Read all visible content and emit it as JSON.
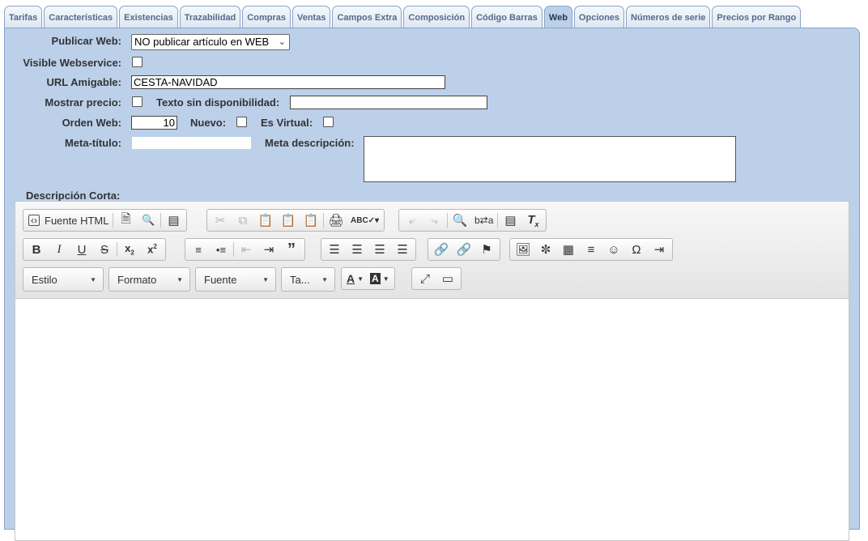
{
  "tabs": [
    {
      "label": "Tarifas"
    },
    {
      "label": "Características"
    },
    {
      "label": "Existencias"
    },
    {
      "label": "Trazabilidad"
    },
    {
      "label": "Compras"
    },
    {
      "label": "Ventas"
    },
    {
      "label": "Campos Extra"
    },
    {
      "label": "Composición"
    },
    {
      "label": "Código Barras"
    },
    {
      "label": "Web",
      "active": true
    },
    {
      "label": "Opciones"
    },
    {
      "label": "Números de serie"
    },
    {
      "label": "Precios por Rango"
    }
  ],
  "form": {
    "publicar_web_label": "Publicar Web:",
    "publicar_web_value": "NO publicar artículo en WEB",
    "visible_ws_label": "Visible Webservice:",
    "url_amigable_label": "URL Amigable:",
    "url_amigable_value": "CESTA-NAVIDAD",
    "mostrar_precio_label": "Mostrar precio:",
    "texto_sin_disp_label": "Texto sin disponibilidad:",
    "texto_sin_disp_value": "",
    "orden_web_label": "Orden Web:",
    "orden_web_value": "10",
    "nuevo_label": "Nuevo:",
    "es_virtual_label": "Es Virtual:",
    "meta_titulo_label": "Meta-título:",
    "meta_titulo_value": "",
    "meta_desc_label": "Meta descripción:",
    "desc_corta_label": "Descripción Corta:"
  },
  "editor": {
    "source_label": "Fuente HTML",
    "combos": {
      "estilo": "Estilo",
      "formato": "Formato",
      "fuente": "Fuente",
      "tamano": "Ta..."
    },
    "icons": {
      "source": "source-icon",
      "new_page": "new-page-icon",
      "preview": "preview-icon",
      "templates": "templates-icon",
      "cut": "cut-icon",
      "copy": "copy-icon",
      "paste": "paste-icon",
      "paste_text": "paste-text-icon",
      "paste_word": "paste-word-icon",
      "print": "print-icon",
      "spellcheck": "spellcheck-icon",
      "undo": "undo-icon",
      "redo": "redo-icon",
      "find": "find-icon",
      "replace": "replace-icon",
      "select_all": "select-all-icon",
      "remove_format": "remove-format-icon"
    }
  }
}
